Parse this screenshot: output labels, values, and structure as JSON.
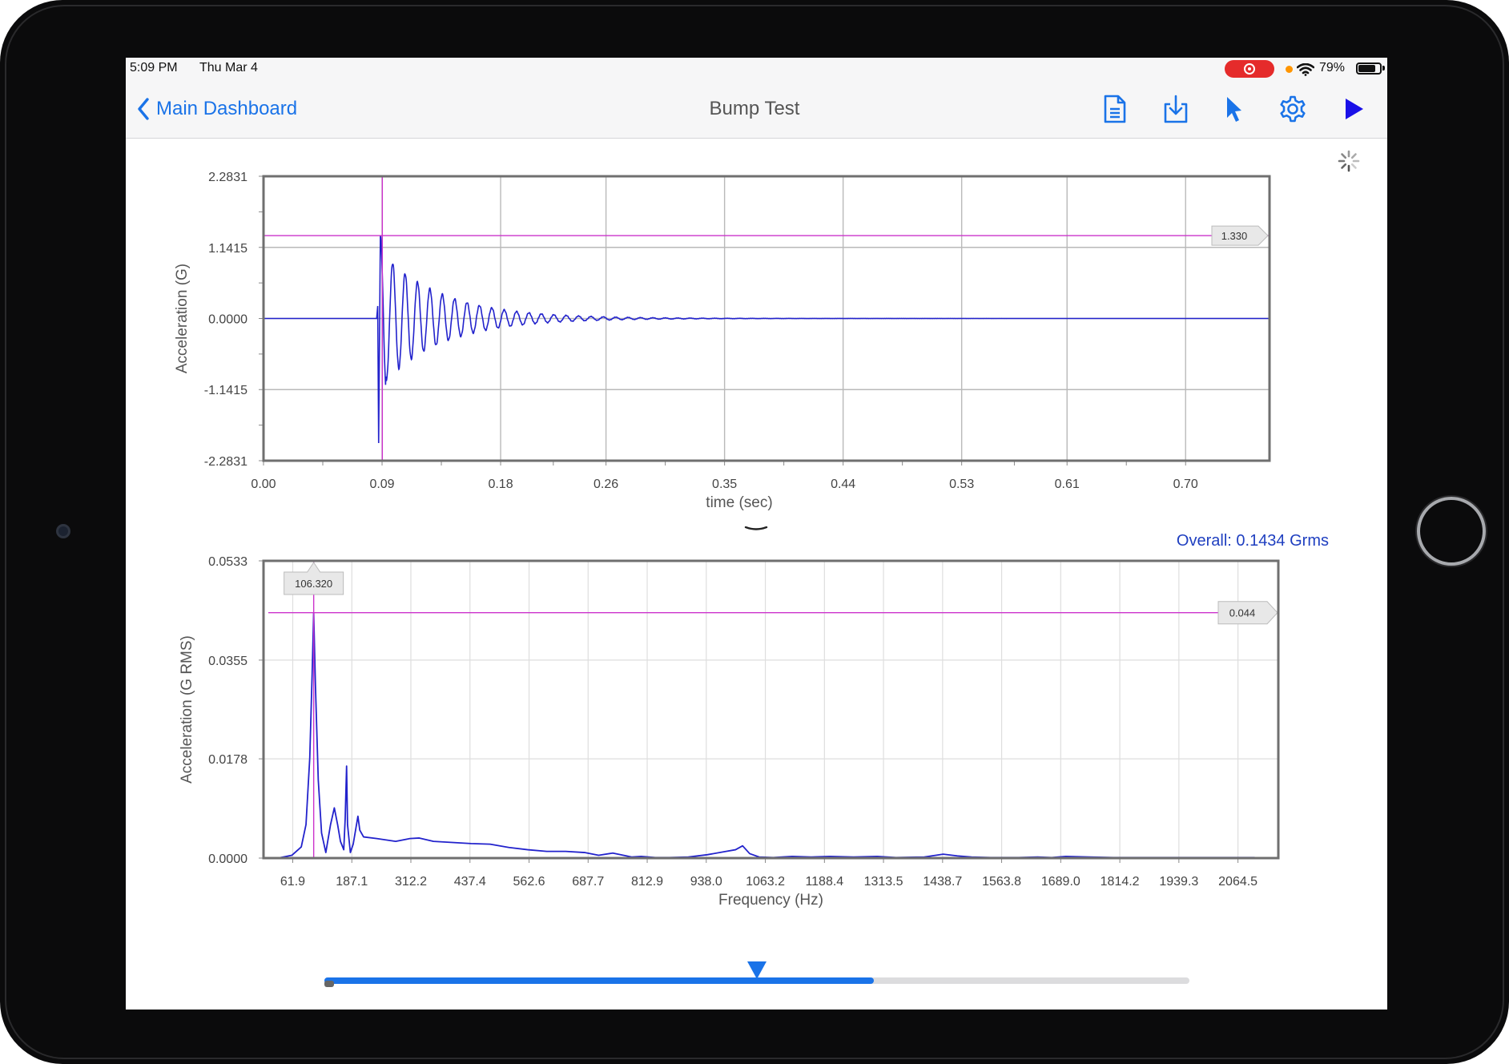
{
  "status": {
    "time": "5:09 PM",
    "date": "Thu Mar 4",
    "battery": "79%",
    "battery_level": 0.79
  },
  "nav": {
    "back_label": "Main Dashboard",
    "title": "Bump Test",
    "icons": [
      "document-icon",
      "download-icon",
      "cursor-icon",
      "gear-icon",
      "play-icon"
    ]
  },
  "colors": {
    "accent": "#1a73e8",
    "signal": "#2222cc",
    "cursor": "#cc33cc",
    "overall_text": "#1f3fc0"
  },
  "overall": "Overall: 0.1434 Grms",
  "chart_data": [
    {
      "type": "line",
      "xlabel": "time (sec)",
      "ylabel": "Acceleration (G)",
      "x_ticks": [
        "0.00",
        "0.09",
        "0.18",
        "0.26",
        "0.35",
        "0.44",
        "0.53",
        "0.61",
        "0.70"
      ],
      "y_ticks": [
        "2.2831",
        "1.1415",
        "0.0000",
        "-1.1415",
        "-2.2831"
      ],
      "xlim": [
        0,
        0.7637
      ],
      "ylim": [
        -2.2831,
        2.2831
      ],
      "grid": true,
      "signal": {
        "type": "damped-oscillation",
        "start": 0.0859,
        "amplitude": 1.33,
        "frequency_hz": 106.32,
        "decay": 22
      },
      "vertical_cursor": 0.0902,
      "horizontal_cursor": {
        "value": 1.33,
        "label": "1.330"
      }
    },
    {
      "type": "line",
      "xlabel": "Frequency (Hz)",
      "ylabel": "Acceleration (G RMS)",
      "x_ticks": [
        "61.9",
        "187.1",
        "312.2",
        "437.4",
        "562.6",
        "687.7",
        "812.9",
        "938.0",
        "1063.2",
        "1188.4",
        "1313.5",
        "1438.7",
        "1563.8",
        "1689.0",
        "1814.2",
        "1939.3",
        "2064.5"
      ],
      "y_ticks": [
        "0.0533",
        "0.0355",
        "0.0178",
        "0.0000"
      ],
      "xlim": [
        0,
        2150
      ],
      "ylim": [
        0,
        0.0533
      ],
      "grid": true,
      "points": [
        [
          30,
          0.0
        ],
        [
          60,
          0.0005
        ],
        [
          80,
          0.002
        ],
        [
          90,
          0.006
        ],
        [
          98,
          0.018
        ],
        [
          103,
          0.033
        ],
        [
          106.3,
          0.044
        ],
        [
          110,
          0.031
        ],
        [
          116,
          0.014
        ],
        [
          123,
          0.0045
        ],
        [
          132,
          0.001
        ],
        [
          142,
          0.006
        ],
        [
          150,
          0.009
        ],
        [
          157,
          0.006
        ],
        [
          163,
          0.003
        ],
        [
          170,
          0.0015
        ],
        [
          173,
          0.007
        ],
        [
          176,
          0.0165
        ],
        [
          178,
          0.006
        ],
        [
          184,
          0.001
        ],
        [
          190,
          0.0025
        ],
        [
          196,
          0.0055
        ],
        [
          200,
          0.0075
        ],
        [
          204,
          0.005
        ],
        [
          212,
          0.0038
        ],
        [
          240,
          0.0035
        ],
        [
          280,
          0.003
        ],
        [
          310,
          0.0035
        ],
        [
          330,
          0.0036
        ],
        [
          360,
          0.003
        ],
        [
          400,
          0.0028
        ],
        [
          440,
          0.0026
        ],
        [
          480,
          0.0025
        ],
        [
          520,
          0.0019
        ],
        [
          560,
          0.0015
        ],
        [
          600,
          0.0012
        ],
        [
          640,
          0.0012
        ],
        [
          680,
          0.001
        ],
        [
          710,
          0.0005
        ],
        [
          740,
          0.0009
        ],
        [
          780,
          0.0002
        ],
        [
          800,
          0.0003
        ],
        [
          830,
          0.0001
        ],
        [
          860,
          0.0001
        ],
        [
          900,
          0.0002
        ],
        [
          940,
          0.0006
        ],
        [
          980,
          0.0012
        ],
        [
          1000,
          0.0015
        ],
        [
          1015,
          0.0022
        ],
        [
          1030,
          0.0008
        ],
        [
          1050,
          0.0002
        ],
        [
          1080,
          0.0001
        ],
        [
          1120,
          0.0003
        ],
        [
          1160,
          0.0002
        ],
        [
          1200,
          0.0003
        ],
        [
          1250,
          0.0002
        ],
        [
          1300,
          0.0003
        ],
        [
          1340,
          0.0001
        ],
        [
          1400,
          0.0002
        ],
        [
          1440,
          0.0007
        ],
        [
          1470,
          0.0004
        ],
        [
          1500,
          0.0002
        ],
        [
          1540,
          0.0001
        ],
        [
          1600,
          0.0001
        ],
        [
          1640,
          0.0002
        ],
        [
          1670,
          0.0001
        ],
        [
          1700,
          0.0003
        ],
        [
          1750,
          0.0002
        ],
        [
          1800,
          0.0001
        ],
        [
          1850,
          0.0001
        ],
        [
          1900,
          0.0001
        ],
        [
          2000,
          0.0001
        ],
        [
          2100,
          0.0001
        ]
      ],
      "vertical_cursor": {
        "value": 106.32,
        "label": "106.320"
      },
      "horizontal_cursor": {
        "value": 0.044,
        "label": "0.044"
      }
    }
  ],
  "slider": {
    "fill_fraction": 0.635,
    "thumb_fraction": 0.5
  }
}
